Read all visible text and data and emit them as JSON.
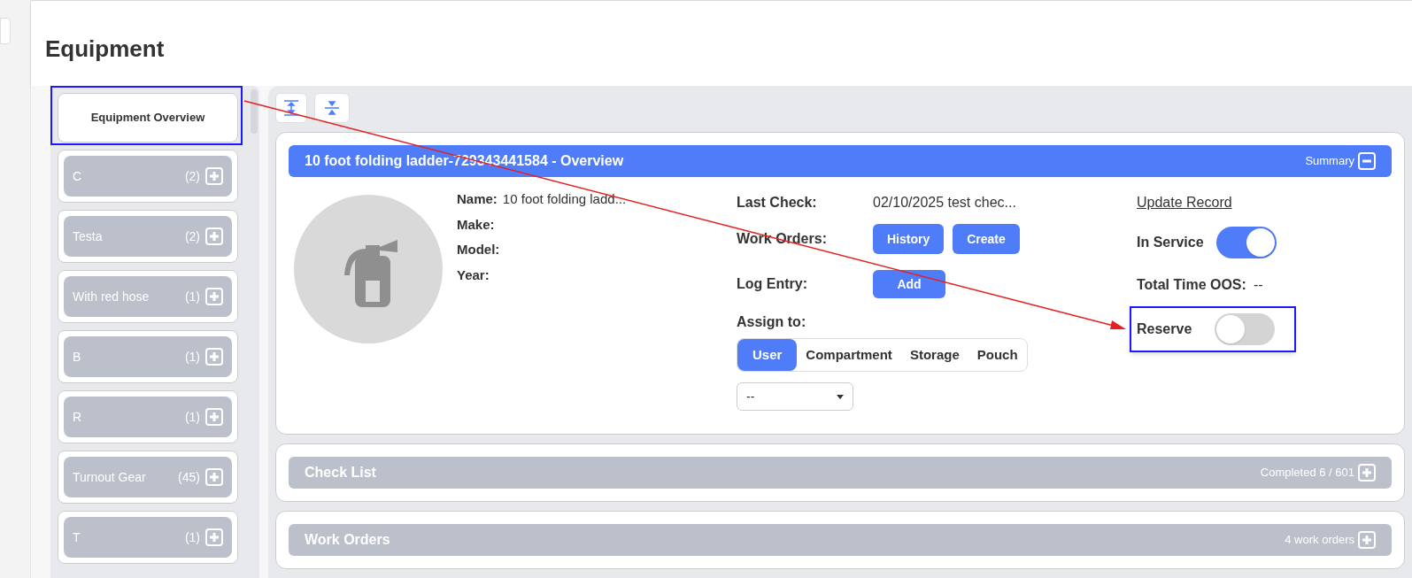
{
  "page_title": "Equipment",
  "sidebar": {
    "overview": "Equipment Overview",
    "items": [
      {
        "label": "C",
        "count": "(2)"
      },
      {
        "label": "Testa",
        "count": "(2)"
      },
      {
        "label": "With red hose",
        "count": "(1)"
      },
      {
        "label": "B",
        "count": "(1)"
      },
      {
        "label": "R",
        "count": "(1)"
      },
      {
        "label": "Turnout Gear",
        "count": "(45)"
      },
      {
        "label": "T",
        "count": "(1)"
      }
    ]
  },
  "overview": {
    "title": "10 foot folding ladder-729343441584 - Overview",
    "summary": "Summary",
    "expanded": true,
    "fields": [
      {
        "label": "Name:",
        "value": "10 foot folding ladd..."
      },
      {
        "label": "Make:"
      },
      {
        "label": "Model:"
      },
      {
        "label": "Year:"
      }
    ],
    "last_check": {
      "label": "Last Check:",
      "value": "02/10/2025 test chec..."
    },
    "work_orders": {
      "label": "Work Orders:",
      "buttons": [
        "History",
        "Create"
      ]
    },
    "log_entry": {
      "label": "Log Entry:",
      "button": "Add"
    },
    "assign": {
      "label": "Assign to:",
      "tabs": [
        {
          "label": "User",
          "selected": true
        },
        {
          "label": "Compartment",
          "selected": false
        },
        {
          "label": "Storage",
          "selected": false
        },
        {
          "label": "Pouch",
          "selected": false
        }
      ],
      "select_value": "--"
    },
    "update_link": "Update Record",
    "in_service": {
      "label": "In Service",
      "on": true
    },
    "oos": {
      "label": "Total Time OOS:",
      "value": "--"
    },
    "reserve": {
      "label": "Reserve",
      "on": false
    }
  },
  "sections": [
    {
      "title": "Check List",
      "info": "Completed 6 / 601",
      "expanded": false
    },
    {
      "title": "Work Orders",
      "info": "4 work orders",
      "expanded": false
    }
  ]
}
